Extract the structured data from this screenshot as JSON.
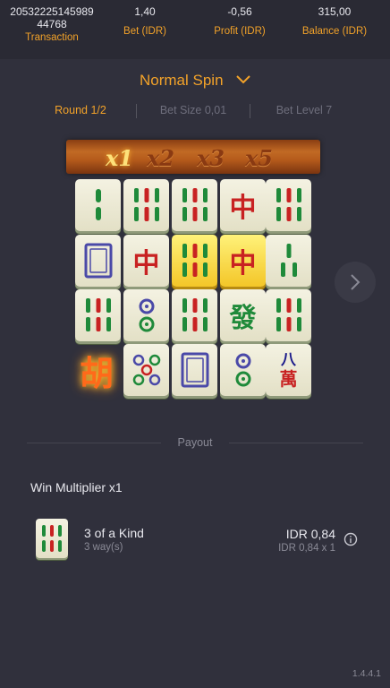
{
  "topbar": {
    "transaction": {
      "value_line1": "20532225145989",
      "value_line2": "44768",
      "label": "Transaction"
    },
    "bet": {
      "value": "1,40",
      "label": "Bet (IDR)"
    },
    "profit": {
      "value": "-0,56",
      "label": "Profit (IDR)"
    },
    "balance": {
      "value": "315,00",
      "label": "Balance (IDR)"
    }
  },
  "spin": {
    "title": "Normal Spin"
  },
  "info": {
    "round": "Round 1/2",
    "bet_size": "Bet Size 0,01",
    "bet_level": "Bet Level 7"
  },
  "multipliers": [
    "x1",
    "x2",
    "x3",
    "x5"
  ],
  "active_multiplier_index": 0,
  "grid": {
    "rows": [
      [
        "bamboo-2",
        "bamboo-6",
        "bamboo-6",
        "red-dragon",
        "bamboo-6"
      ],
      [
        "white-dragon",
        "red-dragon",
        "bamboo-6-gold",
        "red-dragon-gold",
        "bamboo-3"
      ],
      [
        "bamboo-6",
        "dot-2",
        "bamboo-6",
        "green-dragon",
        "bamboo-6"
      ],
      [
        "wild-hu",
        "dot-5",
        "white-dragon",
        "dot-2",
        "character-8"
      ]
    ],
    "glyphs": {
      "red-dragon": "中",
      "green-dragon": "發",
      "wild-hu": "胡",
      "character-8-top": "八",
      "character-8-bottom": "萬"
    }
  },
  "payout": {
    "label": "Payout",
    "win_multiplier": "Win Multiplier x1",
    "rows": [
      {
        "icon": "bamboo-6-icon",
        "name": "3 of a Kind",
        "ways": "3 way(s)",
        "amount": "IDR 0,84",
        "calc": "IDR 0,84 x 1"
      }
    ]
  },
  "version": "1.4.4.1",
  "colors": {
    "accent": "#f2a229",
    "background": "#30303c",
    "topbar": "#2a2a34"
  }
}
